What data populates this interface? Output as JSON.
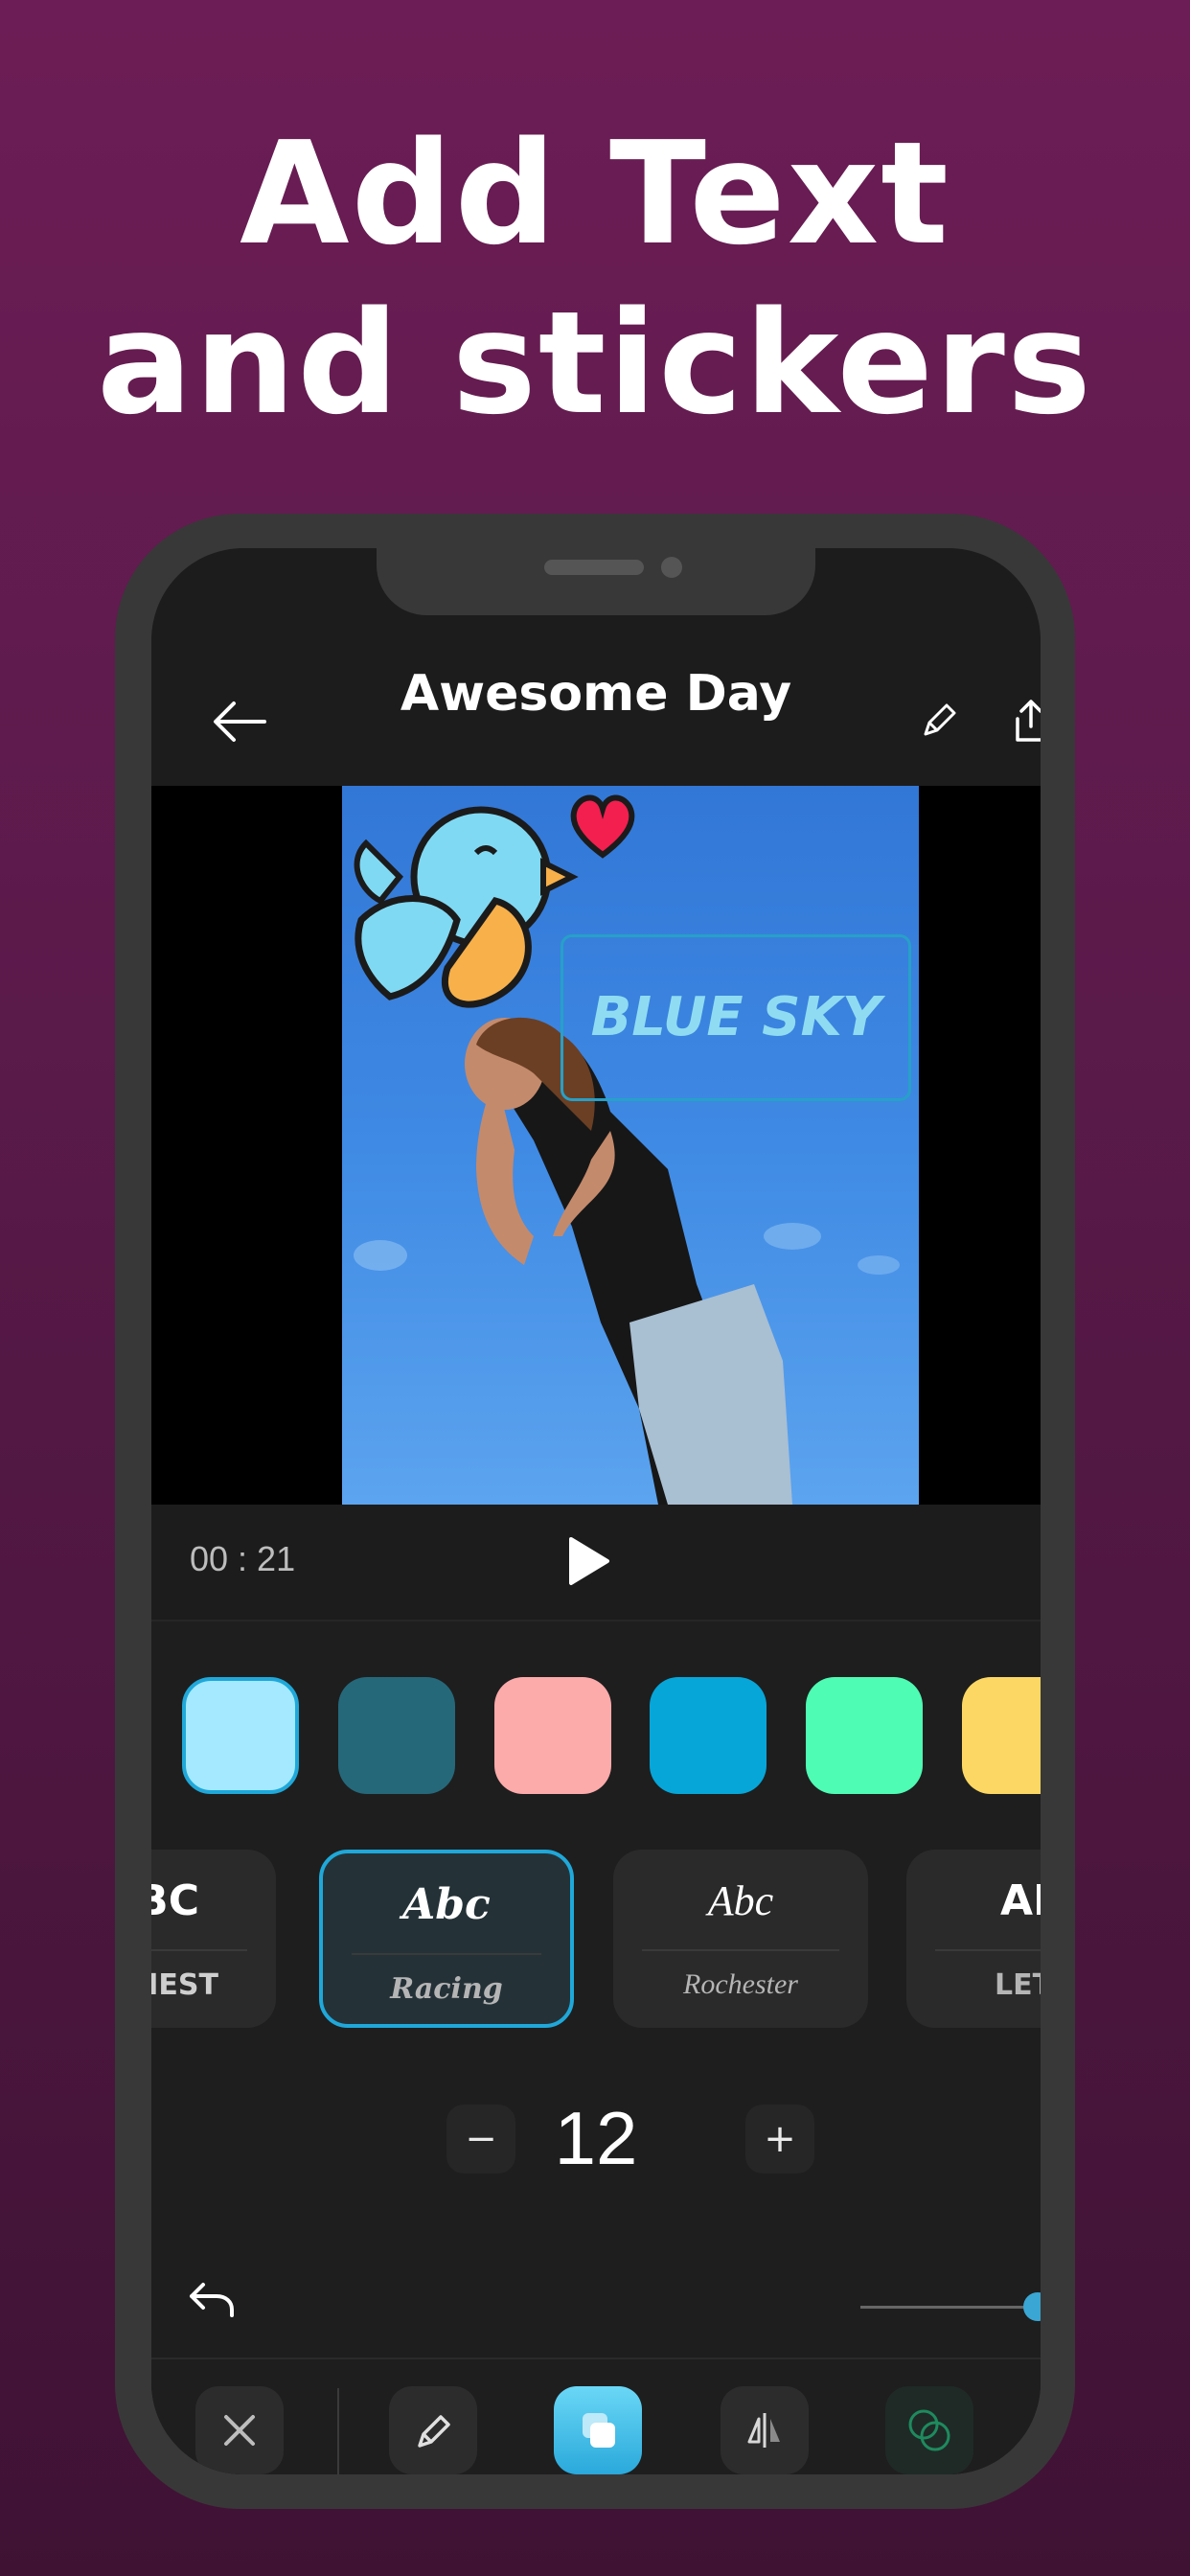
{
  "headline": {
    "line1": "Add Text",
    "line2": "and  stickers"
  },
  "app": {
    "title": "Awesome Day",
    "sticker_text": "BLUE SKY",
    "time": "00 : 21",
    "colors": [
      "#a4e9ff",
      "#25687a",
      "#fdaaab",
      "#06a6d9",
      "#4efcb4",
      "#fcd763"
    ],
    "selected_color_index": 0,
    "fonts": [
      {
        "abc": "BC",
        "name": "IEST"
      },
      {
        "abc": "Abc",
        "name": "Racing"
      },
      {
        "abc": "Abc",
        "name": "Rochester"
      },
      {
        "abc": "AB",
        "name": "LETT"
      }
    ],
    "selected_font_index": 1,
    "size": {
      "minus": "−",
      "value": "12",
      "plus": "+"
    },
    "toolbar": [
      "close-icon",
      "pencil-icon",
      "layers-icon",
      "flip-icon",
      "blend-icon"
    ],
    "accent": "#1fa8d9"
  }
}
